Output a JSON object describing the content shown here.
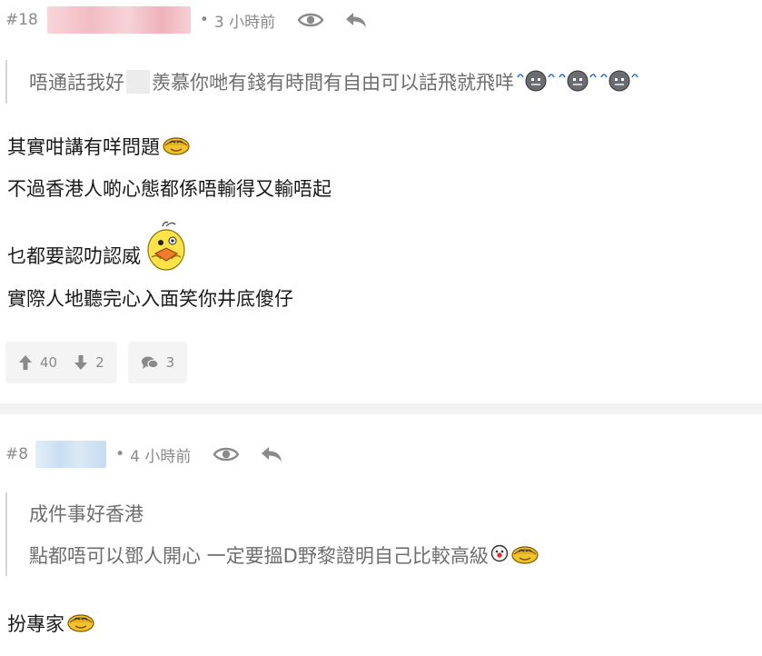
{
  "post18": {
    "floor": "#18",
    "dot": "•",
    "time": "3 小時前",
    "quote_a": "唔通話我好",
    "quote_b": "羨慕你哋有錢有時間有自由可以話飛就飛咩",
    "lines": [
      "其實咁講有咩問題",
      "不過香港人啲心態都係唔輸得又輸唔起",
      "乜都要認叻認威",
      "實際人地聽完心入面笑你井底傻仔"
    ],
    "upvotes": "40",
    "downvotes": "2",
    "replies": "3"
  },
  "post8": {
    "floor": "#8",
    "dot": "•",
    "time": "4 小時前",
    "quote_lines": [
      "成件事好香港",
      "點都唔可以鄧人開心 一定要搵D野黎證明自己比較高級"
    ],
    "lines": [
      "扮專家"
    ]
  },
  "colors": {
    "name_blur_18": "#f0b7bd",
    "name_blur_8": "#cfe3f3",
    "icon_gray": "#8a8a8a"
  }
}
